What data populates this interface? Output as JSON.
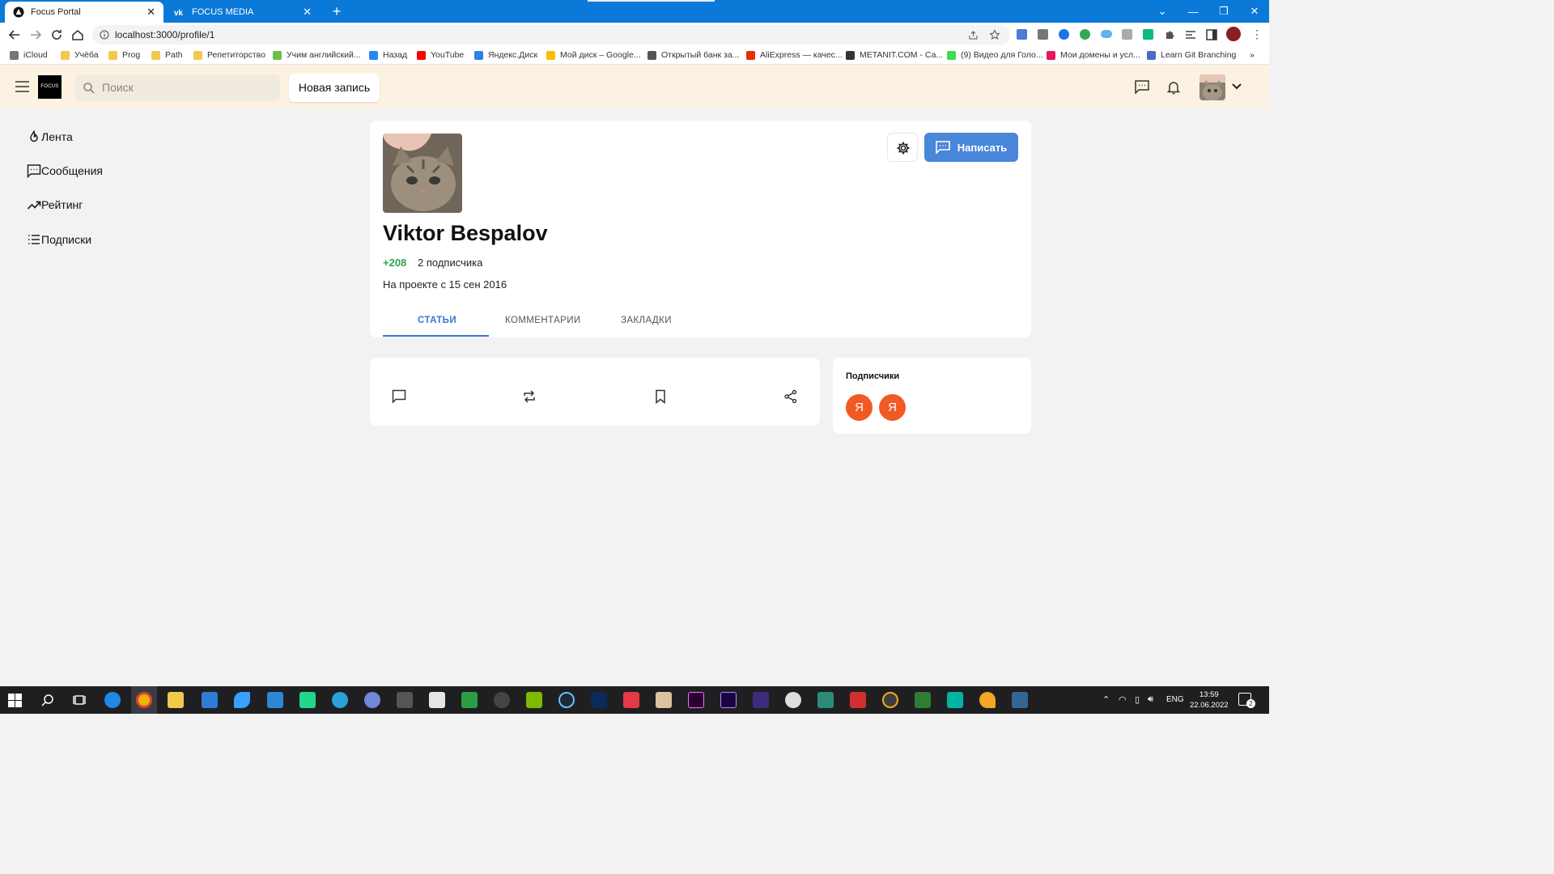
{
  "browser": {
    "tabs": [
      {
        "title": "Focus Portal",
        "active": true
      },
      {
        "title": "FOCUS MEDIA",
        "active": false
      }
    ],
    "url": "localhost:3000/profile/1",
    "bookmarks": [
      {
        "label": "iCloud",
        "color": "#777777"
      },
      {
        "label": "Учёба",
        "color": "#f2c94c"
      },
      {
        "label": "Prog",
        "color": "#f2c94c"
      },
      {
        "label": "Path",
        "color": "#f2c94c"
      },
      {
        "label": "Репетиторство",
        "color": "#f2c94c"
      },
      {
        "label": "Учим английский...",
        "color": "#6abf4b"
      },
      {
        "label": "Назад",
        "color": "#2787f5"
      },
      {
        "label": "YouTube",
        "color": "#ff0000"
      },
      {
        "label": "Яндекс.Диск",
        "color": "#2f80ed"
      },
      {
        "label": "Мой диск – Google...",
        "color": "#fbbc04"
      },
      {
        "label": "Открытый банк за...",
        "color": "#555555"
      },
      {
        "label": "AliExpress — качес...",
        "color": "#e62e04"
      },
      {
        "label": "METANIT.COM - Са...",
        "color": "#333333"
      },
      {
        "label": "(9) Видео для Голо...",
        "color": "#43d854"
      },
      {
        "label": "Мои домены и усл...",
        "color": "#e8175d"
      },
      {
        "label": "Learn Git Branching",
        "color": "#4a6cc3"
      }
    ]
  },
  "header": {
    "logo_text": "FOCUS",
    "search_placeholder": "Поиск",
    "new_post_label": "Новая запись"
  },
  "sidebar": {
    "items": [
      {
        "label": "Лента",
        "icon": "fire-icon"
      },
      {
        "label": "Сообщения",
        "icon": "message-icon"
      },
      {
        "label": "Рейтинг",
        "icon": "trending-up-icon"
      },
      {
        "label": "Подписки",
        "icon": "list-icon"
      }
    ]
  },
  "profile": {
    "name": "Viktor Bespalov",
    "rating": "+208",
    "subscribers": "2 подписчика",
    "since": "На проекте с 15 сен 2016",
    "write_label": "Написать",
    "tabs": [
      "СТАТЬИ",
      "КОММЕНТАРИИ",
      "ЗАКЛАДКИ"
    ],
    "active_tab": "СТАТЬИ"
  },
  "subscribers_card": {
    "title": "Подписчики",
    "avatars": [
      "Я",
      "Я"
    ]
  },
  "taskbar": {
    "lang": "ENG",
    "time": "13:59",
    "date": "22.06.2022",
    "notifications": "2"
  },
  "colors": {
    "accent": "#4a86d9",
    "rating_green": "#2ea44f",
    "header_bg": "#fdf2e1",
    "avatar_orange": "#f15a24"
  }
}
